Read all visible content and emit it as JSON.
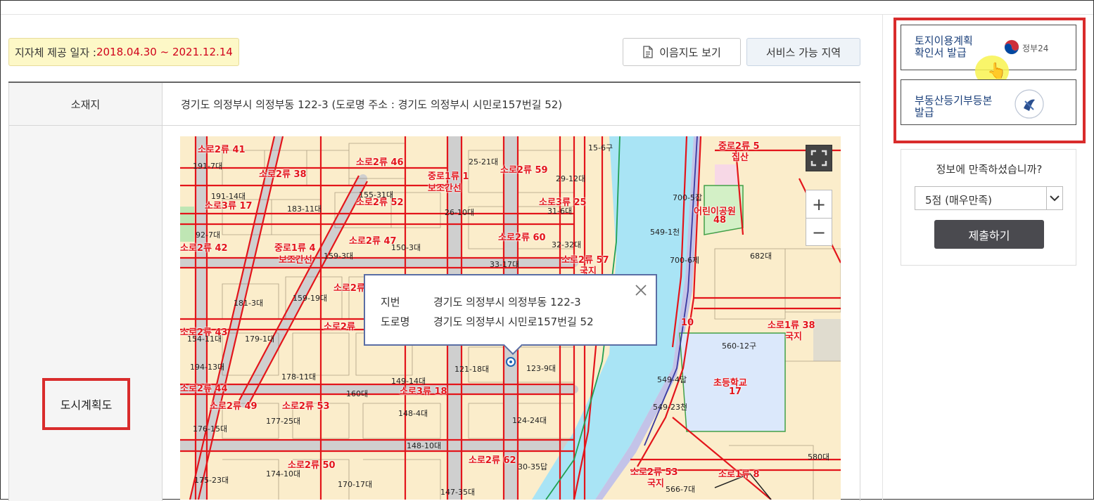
{
  "provide_date": {
    "label": "지자체 제공 일자 : ",
    "value": "2018.04.30 ~ 2021.12.14"
  },
  "toolbar": {
    "map_button": "이음지도 보기",
    "area_button": "서비스 가능 지역"
  },
  "location": {
    "header": "소재지",
    "address": "경기도 의정부시 의정부동 122-3 (도로명 주소 : 경기도 의정부시 시민로157번길 52)"
  },
  "city_plan": {
    "header": "도시계획도"
  },
  "popup": {
    "rows": [
      {
        "key": "지번",
        "value": "경기도 의정부시 의정부동 122-3"
      },
      {
        "key": "도로명",
        "value": "경기도 의정부시 시민로157번길 52"
      }
    ]
  },
  "map_controls": {
    "zoom_in": "+",
    "zoom_out": "−"
  },
  "map_labels": {
    "road_labels": [
      "소로2류 41",
      "소로2류 38",
      "소로2류 46",
      "중로1류 1",
      "보조간선",
      "소로2류 59",
      "소로3류 17",
      "소로2류 52",
      "소로3류 25",
      "소로2류 47",
      "소로2류 60",
      "소로2류 42",
      "중로1류 4",
      "보조간선",
      "소로2류 57",
      "국지",
      "소로2류",
      "소로2류 43",
      "소로2류",
      "소로2류 44",
      "소로3류 18",
      "소로2류 49",
      "소로2류 53",
      "소로2류 50",
      "소로2류 62",
      "소로2류 53",
      "국지",
      "소로1류 8",
      "중로2류 5",
      "집산",
      "소로1류 38",
      "국지",
      "10",
      "어린이공원",
      "48",
      "초등학교",
      "17"
    ],
    "parcel_labels": [
      "191-7대",
      "191-14대",
      "183-11대",
      "155-31대",
      "26-10대",
      "25-21대",
      "29-12대",
      "31-6대",
      "32-32대",
      "33-17대",
      "92-7대",
      "181-3대",
      "159-3대",
      "150-3대",
      "159-19대",
      "179-1대",
      "178-11대",
      "154-11대",
      "194-13대",
      "176-15대",
      "177-25대",
      "175-23대",
      "174-10대",
      "170-17대",
      "160대",
      "149-14대",
      "121-18대",
      "123-9대",
      "148-4대",
      "124-24대",
      "148-10대",
      "30-35답",
      "147-35대",
      "15-6구",
      "700-5잡",
      "549-1천",
      "700-6제",
      "682대",
      "560-12구",
      "549-4답",
      "549-23천",
      "580대",
      "566-7대"
    ]
  },
  "issue": {
    "land_plan": {
      "line1": "토지이용계획",
      "line2": "확인서 발급",
      "gov_brand": "정부24"
    },
    "registry": {
      "line1": "부동산등기부등본",
      "line2": "발급"
    }
  },
  "survey": {
    "question": "정보에 만족하셨습니까?",
    "selected": "5점 (매우만족)",
    "submit": "제출하기"
  },
  "colors": {
    "accent_red": "#d92c2c",
    "road_red": "#e3151b",
    "river": "#a9e4f5",
    "parcel": "#fbedcb"
  }
}
